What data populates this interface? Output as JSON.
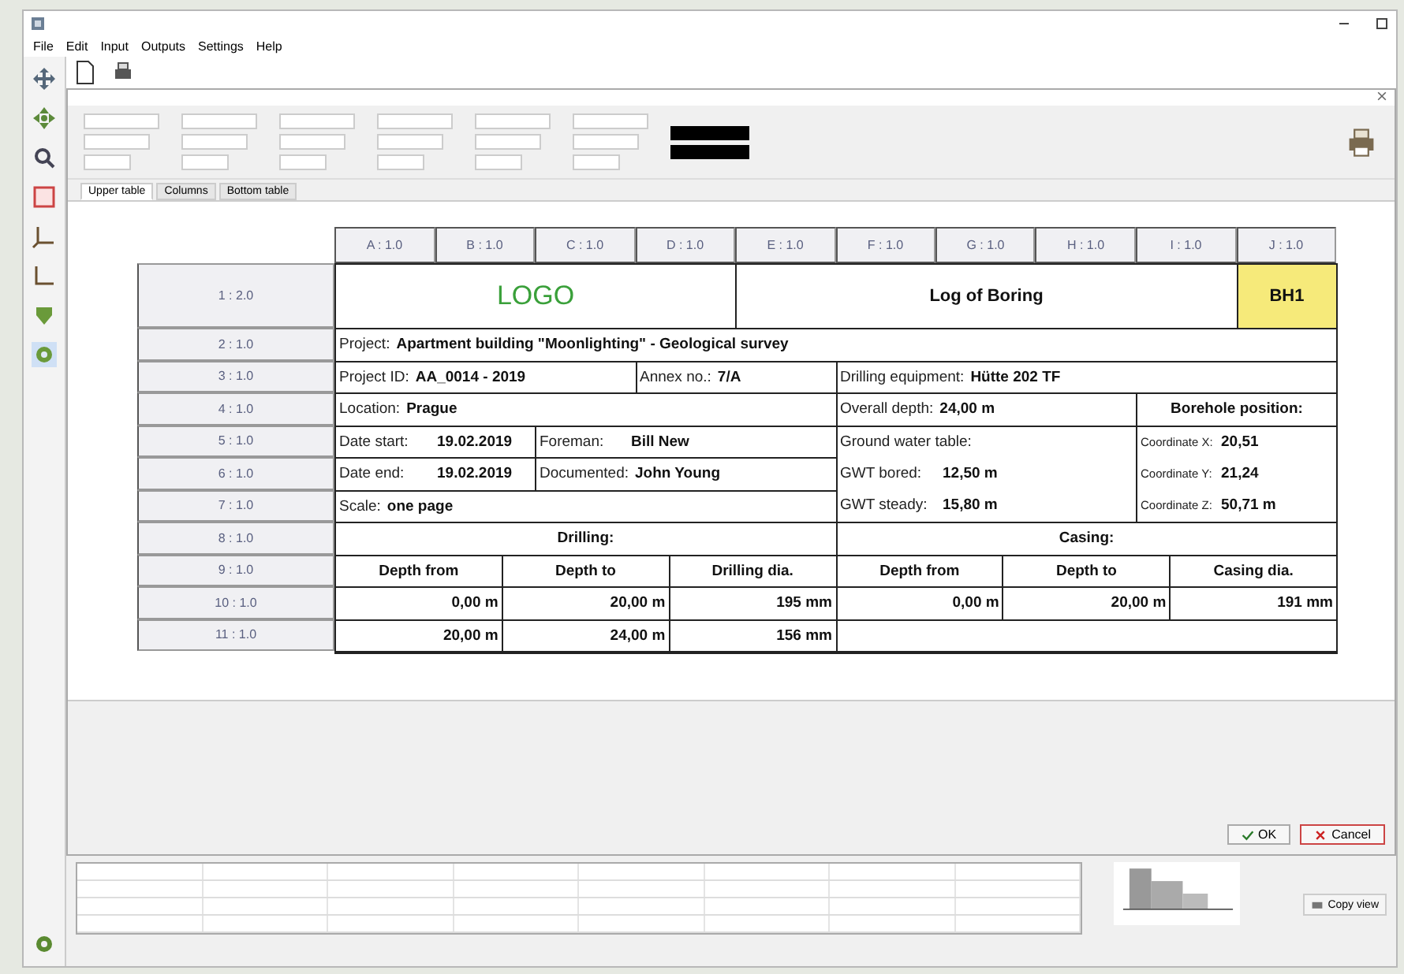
{
  "menu": [
    "File",
    "Edit",
    "Input",
    "Outputs",
    "Settings",
    "Help"
  ],
  "tabs": [
    {
      "label": "Upper table",
      "selected": true
    },
    {
      "label": "Columns",
      "selected": false
    },
    {
      "label": "Bottom table",
      "selected": false
    }
  ],
  "table": {
    "columns": [
      "A : 1.0",
      "B : 1.0",
      "C : 1.0",
      "D : 1.0",
      "E : 1.0",
      "F : 1.0",
      "G : 1.0",
      "H : 1.0",
      "I : 1.0",
      "J : 1.0"
    ],
    "rows": [
      "1 : 2.0",
      "2 : 1.0",
      "3 : 1.0",
      "4 : 1.0",
      "5 : 1.0",
      "6 : 1.0",
      "7 : 1.0",
      "8 : 1.0",
      "9 : 1.0",
      "10 : 1.0",
      "11 : 1.0"
    ],
    "cells": [
      {
        "kind": "logo",
        "text": "LOGO"
      },
      {
        "kind": "title",
        "text": "Log of Boring"
      },
      {
        "kind": "badge",
        "text": "BH1"
      },
      {
        "kind": "pair",
        "label": "Project:",
        "value": "Apartment building \"Moonlighting\" - Geological survey"
      },
      {
        "kind": "pair",
        "label": "Project ID:",
        "value": "AA_0014 - 2019"
      },
      {
        "kind": "pair",
        "label": "Annex no.:",
        "value": "7/A"
      },
      {
        "kind": "pair",
        "label": "Drilling equipment:",
        "value": "Hütte 202 TF"
      },
      {
        "kind": "pair",
        "label": "Location:",
        "value": "Prague"
      },
      {
        "kind": "pair",
        "label": "Overall depth:",
        "value": "24,00 m"
      },
      {
        "kind": "heading",
        "text": "Borehole position:"
      },
      {
        "kind": "pair",
        "label": "Date start:",
        "value": "19.02.2019"
      },
      {
        "kind": "pair",
        "label": "Foreman:",
        "value": "Bill New"
      },
      {
        "kind": "pair",
        "label": "Date end:",
        "value": "19.02.2019"
      },
      {
        "kind": "pair",
        "label": "Documented:",
        "value": "John Young"
      },
      {
        "kind": "pair",
        "label": "Scale:",
        "value": "one page"
      },
      {
        "kind": "stack",
        "lines": [
          {
            "label": "Ground water table:"
          },
          {
            "label": "GWT bored:",
            "value": "12,50 m"
          },
          {
            "label": "GWT steady:",
            "value": "15,80 m"
          }
        ]
      },
      {
        "kind": "stack",
        "lines": [
          {
            "label": "Coordinate X:",
            "value": "20,51"
          },
          {
            "label": "Coordinate Y:",
            "value": "21,24"
          },
          {
            "label": "Coordinate Z:",
            "value": "50,71 m"
          }
        ]
      },
      {
        "kind": "heading",
        "text": "Drilling:"
      },
      {
        "kind": "heading",
        "text": "Casing:"
      },
      {
        "kind": "heading",
        "text": "Depth from"
      },
      {
        "kind": "heading",
        "text": "Depth to"
      },
      {
        "kind": "heading",
        "text": "Drilling dia."
      },
      {
        "kind": "heading",
        "text": "Depth from"
      },
      {
        "kind": "heading",
        "text": "Depth to"
      },
      {
        "kind": "heading",
        "text": "Casing dia."
      },
      {
        "kind": "number",
        "text": "0,00 m"
      },
      {
        "kind": "number",
        "text": "20,00 m"
      },
      {
        "kind": "number",
        "text": "195 mm"
      },
      {
        "kind": "number",
        "text": "0,00 m"
      },
      {
        "kind": "number",
        "text": "20,00 m"
      },
      {
        "kind": "number",
        "text": "191 mm"
      },
      {
        "kind": "number",
        "text": "20,00 m"
      },
      {
        "kind": "number",
        "text": "24,00 m"
      },
      {
        "kind": "number",
        "text": "156 mm"
      }
    ]
  },
  "buttons": [
    {
      "kind": "ok",
      "label": "OK"
    },
    {
      "kind": "cancel",
      "label": "Cancel"
    }
  ],
  "copy_view": "Copy view"
}
